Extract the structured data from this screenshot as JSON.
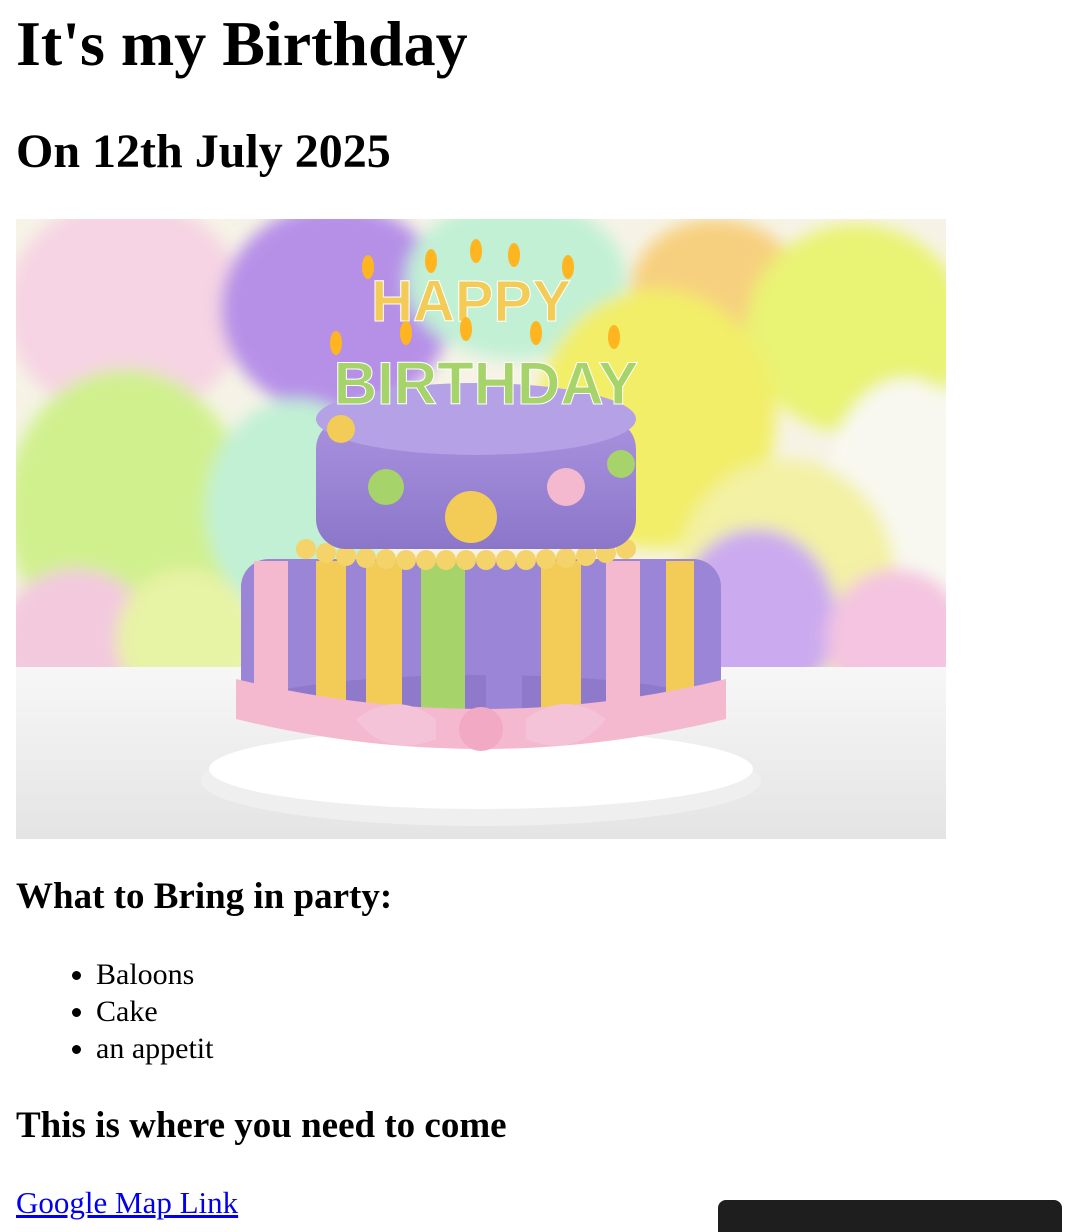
{
  "page": {
    "title": "It's my Birthday",
    "date_heading": "On 12th July 2025"
  },
  "hero_image": {
    "alt": "birthday-cake",
    "cake_candle_text_top": "HAPPY",
    "cake_candle_text_bottom": "BIRTHDAY",
    "colors": {
      "purple": "#9b85d6",
      "yellow": "#f3cc58",
      "green": "#a6d36a",
      "pink": "#f4b9cf",
      "balloon_yellow": "#eef26c",
      "balloon_purple": "#b38be8",
      "balloon_green": "#cff08a"
    }
  },
  "bring_section": {
    "heading": "What to Bring in party:",
    "items": [
      "Baloons",
      "Cake",
      "an appetit"
    ]
  },
  "location_section": {
    "heading": "This is where you need to come",
    "link_text": "Google Map Link"
  }
}
